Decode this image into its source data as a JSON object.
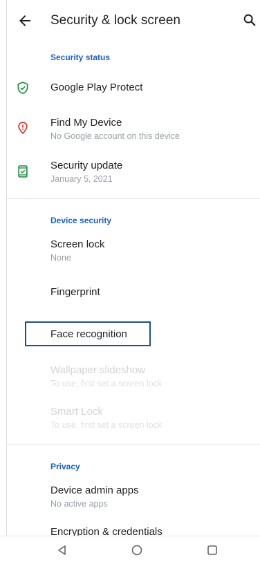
{
  "appbar": {
    "title": "Security & lock screen",
    "back_icon": "arrow-left-icon",
    "search_icon": "search-icon"
  },
  "sections": {
    "security_status": {
      "header": "Security status",
      "items": [
        {
          "title": "Google Play Protect",
          "icon": "shield-check-icon",
          "icon_color": "#1e8e3e"
        },
        {
          "title": "Find My Device",
          "summary": "No Google account on this device",
          "icon": "location-alert-icon",
          "icon_color": "#d93025"
        },
        {
          "title": "Security update",
          "summary": "January 5, 2021",
          "icon": "phone-check-icon",
          "icon_color": "#1e8e3e"
        }
      ]
    },
    "device_security": {
      "header": "Device security",
      "items": [
        {
          "title": "Screen lock",
          "summary": "None"
        },
        {
          "title": "Fingerprint"
        },
        {
          "title": "Face recognition"
        },
        {
          "title": "Wallpaper slideshow",
          "summary": "To use, first set a screen lock",
          "disabled": true
        },
        {
          "title": "Smart Lock",
          "summary": "To use, first set a screen lock",
          "disabled": true
        }
      ]
    },
    "privacy": {
      "header": "Privacy",
      "items": [
        {
          "title": "Device admin apps",
          "summary": "No active apps"
        },
        {
          "title": "Encryption & credentials"
        }
      ]
    }
  },
  "colors": {
    "accent": "#1a5fd0",
    "focus_border": "#1e4f86",
    "shield_green": "#1e8e3e",
    "alert_red": "#d93025"
  },
  "navbar": {
    "back_icon": "triangle-back-icon",
    "home_icon": "circle-home-icon",
    "recents_icon": "square-recents-icon"
  }
}
